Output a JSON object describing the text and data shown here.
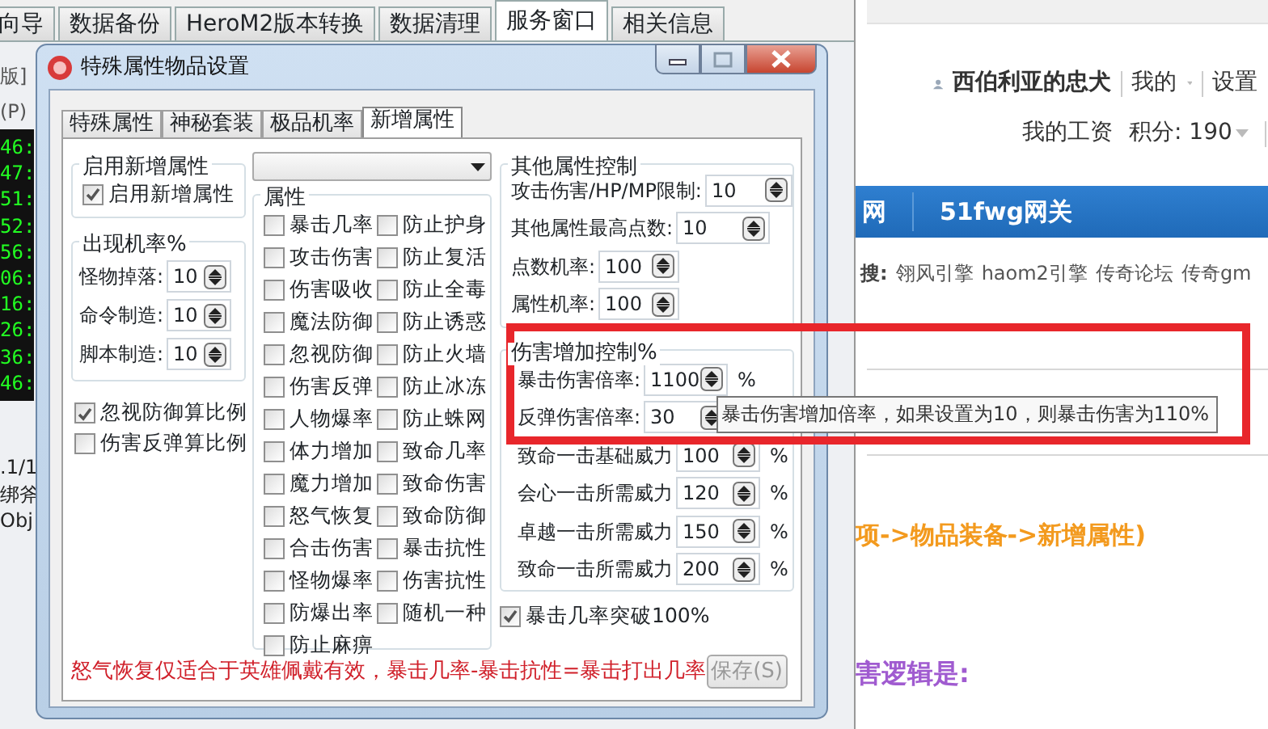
{
  "app_tabs": [
    {
      "label": "向导",
      "selected": false
    },
    {
      "label": "数据备份",
      "selected": false
    },
    {
      "label": "HeroM2版本转换",
      "selected": false
    },
    {
      "label": "数据清理",
      "selected": false
    },
    {
      "label": "服务窗口",
      "selected": true
    },
    {
      "label": "相关信息",
      "selected": false
    }
  ],
  "side_labels": [
    "版]",
    "(P)"
  ],
  "log_lines": [
    "46:",
    "47:",
    "51:",
    "52:",
    "56:",
    "06:",
    "16:",
    "26:",
    "36:",
    "46:"
  ],
  "side_texts": [
    ".1/1",
    "绑斧",
    "Obj"
  ],
  "dialog": {
    "title": "特殊属性物品设置",
    "tabs": [
      {
        "label": "特殊属性",
        "selected": false
      },
      {
        "label": "神秘套装",
        "selected": false
      },
      {
        "label": "极品机率",
        "selected": false
      },
      {
        "label": "新增属性",
        "selected": true
      }
    ],
    "enable_group": {
      "title": "启用新增属性",
      "label": "启用新增属性",
      "checked": true
    },
    "rate_group": {
      "title": "出现机率%",
      "fields": [
        {
          "label": "怪物掉落:",
          "value": "10"
        },
        {
          "label": "命令制造:",
          "value": "10"
        },
        {
          "label": "脚本制造:",
          "value": "10"
        }
      ]
    },
    "options": [
      {
        "label": "忽视防御算比例",
        "checked": true
      },
      {
        "label": "伤害反弹算比例",
        "checked": false
      }
    ],
    "attr_group": {
      "title": "属性",
      "items": [
        {
          "label": "暴击几率",
          "checked": false
        },
        {
          "label": "防止护身",
          "checked": false
        },
        {
          "label": "攻击伤害",
          "checked": false
        },
        {
          "label": "防止复活",
          "checked": false
        },
        {
          "label": "伤害吸收",
          "checked": false
        },
        {
          "label": "防止全毒",
          "checked": false
        },
        {
          "label": "魔法防御",
          "checked": false
        },
        {
          "label": "防止诱惑",
          "checked": false
        },
        {
          "label": "忽视防御",
          "checked": false
        },
        {
          "label": "防止火墙",
          "checked": false
        },
        {
          "label": "伤害反弹",
          "checked": false
        },
        {
          "label": "防止冰冻",
          "checked": false
        },
        {
          "label": "人物爆率",
          "checked": false
        },
        {
          "label": "防止蛛网",
          "checked": false
        },
        {
          "label": "体力增加",
          "checked": false
        },
        {
          "label": "致命几率",
          "checked": false
        },
        {
          "label": "魔力增加",
          "checked": false
        },
        {
          "label": "致命伤害",
          "checked": false
        },
        {
          "label": "怒气恢复",
          "checked": false
        },
        {
          "label": "致命防御",
          "checked": false
        },
        {
          "label": "合击伤害",
          "checked": false
        },
        {
          "label": "暴击抗性",
          "checked": false
        },
        {
          "label": "怪物爆率",
          "checked": false
        },
        {
          "label": "伤害抗性",
          "checked": false
        },
        {
          "label": "防爆出率",
          "checked": false
        },
        {
          "label": "随机一种",
          "checked": false
        },
        {
          "label": "防止麻痹",
          "checked": false
        }
      ]
    },
    "other_group": {
      "title": "其他属性控制",
      "fields": [
        {
          "label": "攻击伤害/HP/MP限制:",
          "value": "10"
        },
        {
          "label": "其他属性最高点数:",
          "value": "10"
        },
        {
          "label": "点数机率:",
          "value": "100"
        },
        {
          "label": "属性机率:",
          "value": "100"
        }
      ]
    },
    "damage_group": {
      "title": "伤害增加控制%",
      "fields": [
        {
          "label": "暴击伤害倍率:",
          "value": "1100",
          "unit": "%"
        },
        {
          "label": "反弹伤害倍率:",
          "value": "30"
        },
        {
          "label": "致命一击基础威力",
          "value": "100",
          "unit": "%"
        },
        {
          "label": "会心一击所需威力",
          "value": "120",
          "unit": "%"
        },
        {
          "label": "卓越一击所需威力",
          "value": "150",
          "unit": "%"
        },
        {
          "label": "致命一击所需威力",
          "value": "200",
          "unit": "%"
        }
      ]
    },
    "breakthrough": {
      "label": "暴击几率突破100%",
      "checked": true
    },
    "note": "怒气恢复仅适合于英雄佩戴有效，暴击几率-暴击抗性=暴击打出几率",
    "save_button": {
      "label": "保存(S)",
      "disabled": true
    }
  },
  "tooltip": "暴击伤害增加倍率，如果设置为10，则暴击伤害为110%",
  "web": {
    "user": "西伯利亚的忠犬",
    "menu": [
      "我的",
      "设置"
    ],
    "wage": "我的工资",
    "points": "积分: 190",
    "nav": [
      "网",
      "51fwg网关"
    ],
    "hot_label": "搜:",
    "hot_links": [
      "翎风引擎",
      "haom2引擎",
      "传奇论坛",
      "传奇gm"
    ],
    "path_text": "项->物品装备->新增属性)",
    "logic_text": "害逻辑是:"
  }
}
